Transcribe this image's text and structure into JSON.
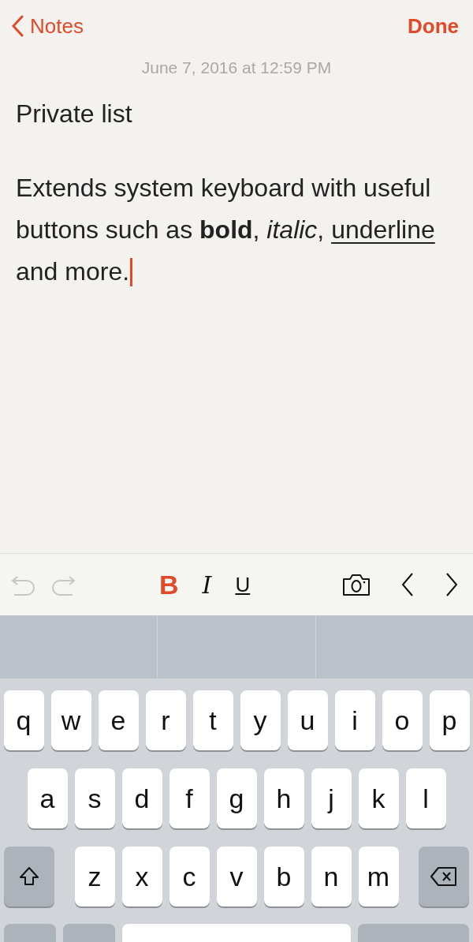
{
  "nav": {
    "back": "Notes",
    "done": "Done"
  },
  "note": {
    "date": "June 7, 2016 at 12:59 PM",
    "title": "Private list",
    "body": [
      {
        "kind": "plain",
        "text": "Extends system keyboard with useful buttons such as "
      },
      {
        "kind": "bold",
        "text": "bold"
      },
      {
        "kind": "plain",
        "text": ", "
      },
      {
        "kind": "italic",
        "text": "italic"
      },
      {
        "kind": "plain",
        "text": ", "
      },
      {
        "kind": "underline",
        "text": "underline"
      },
      {
        "kind": "plain",
        "text": " and more."
      }
    ]
  },
  "toolbar": {
    "history": [
      {
        "kind": "undo",
        "disabled": true
      },
      {
        "kind": "redo",
        "disabled": true
      }
    ],
    "format": [
      {
        "kind": "bold",
        "label": "B",
        "selected": true
      },
      {
        "kind": "italic",
        "label": "I",
        "selected": false
      },
      {
        "kind": "underline",
        "label": "U",
        "selected": false
      }
    ]
  },
  "keyboard": {
    "rows": [
      [
        "q",
        "w",
        "e",
        "r",
        "t",
        "y",
        "u",
        "i",
        "o",
        "p"
      ],
      [
        "a",
        "s",
        "d",
        "f",
        "g",
        "h",
        "j",
        "k",
        "l"
      ],
      [
        "z",
        "x",
        "c",
        "v",
        "b",
        "n",
        "m"
      ]
    ]
  }
}
